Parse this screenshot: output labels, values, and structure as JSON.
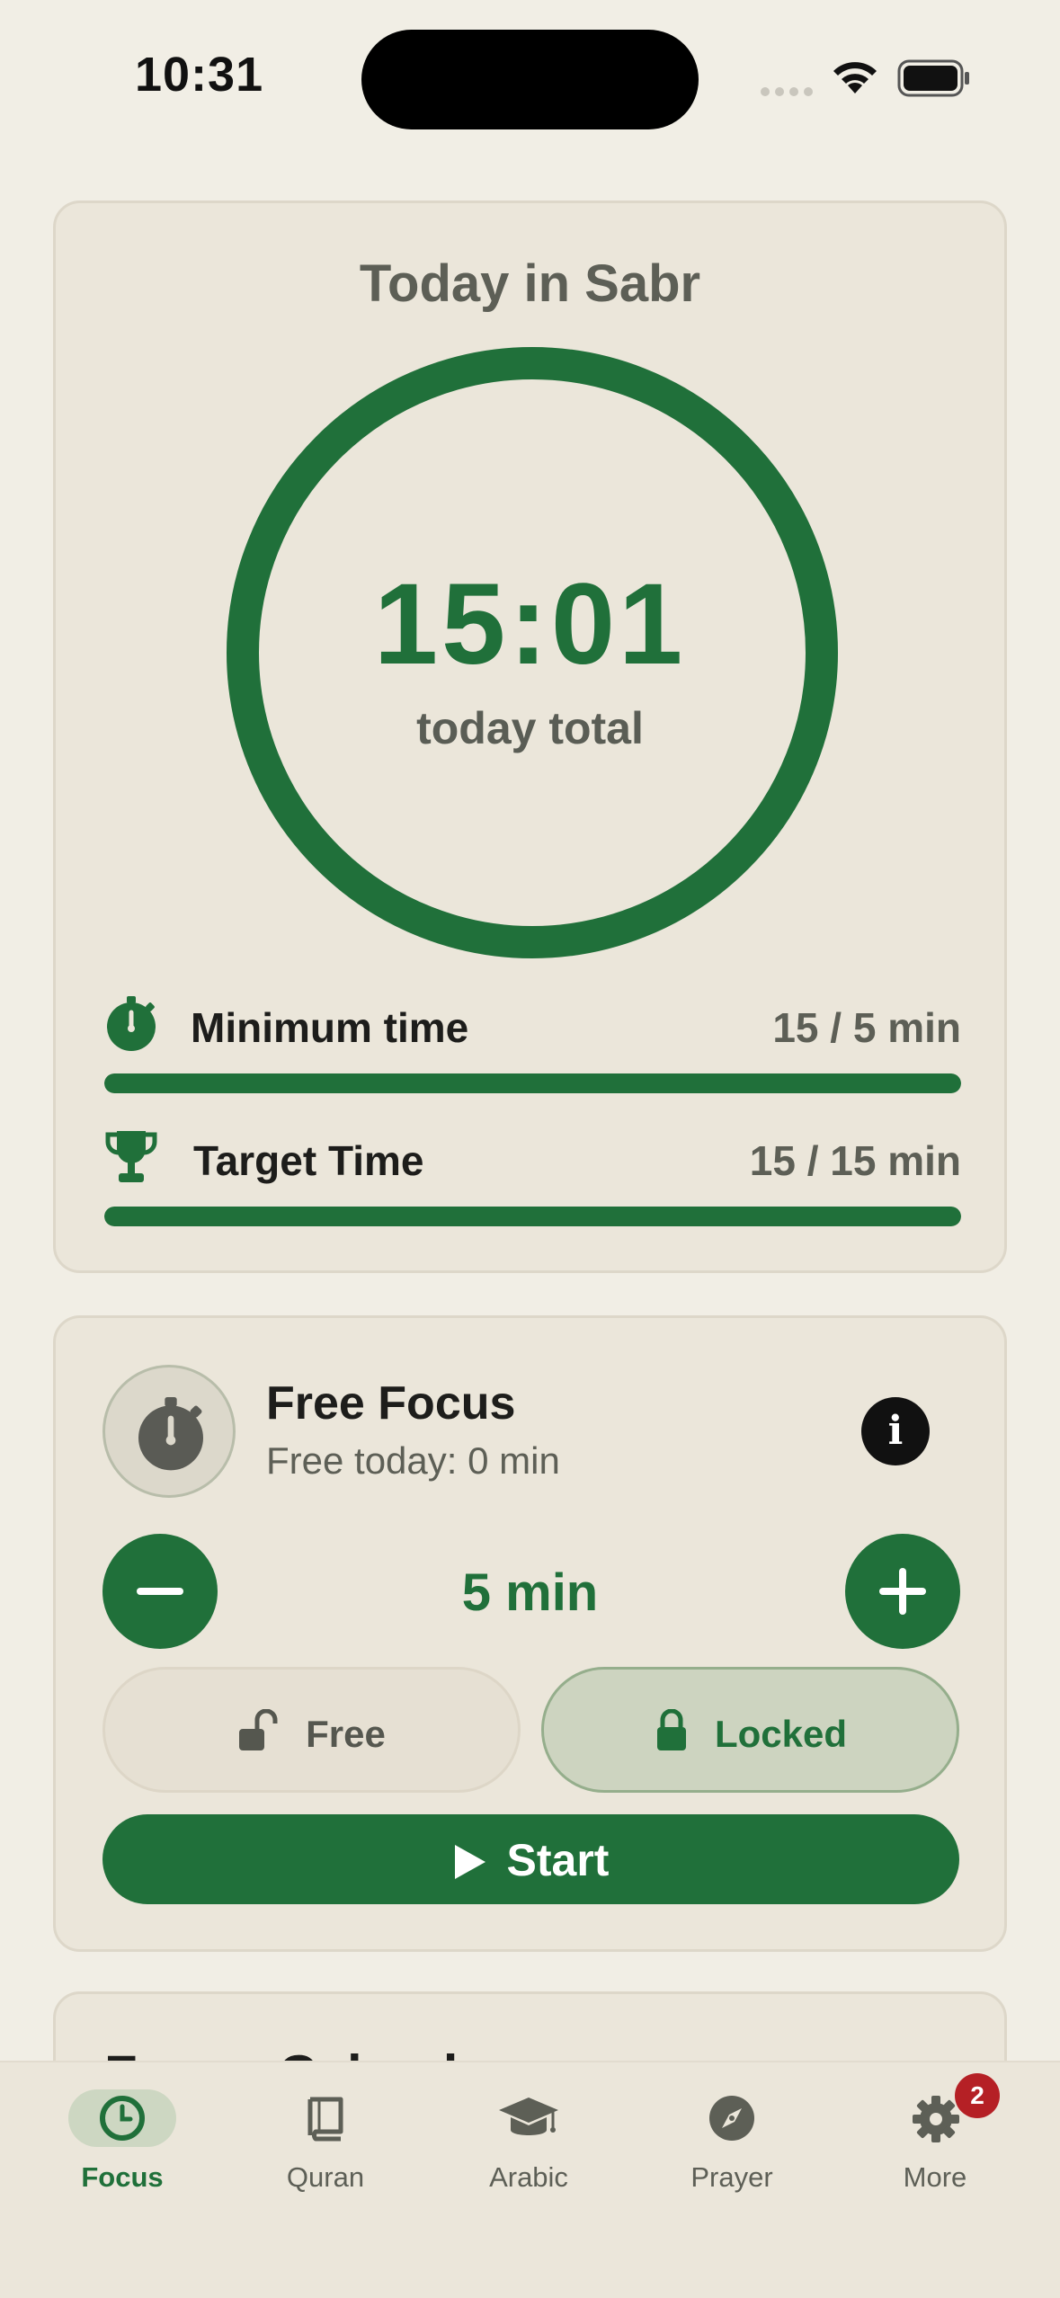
{
  "status_bar": {
    "time": "10:31"
  },
  "today": {
    "title": "Today in Sabr",
    "total_time": "15:01",
    "total_label": "today total",
    "ring_progress": 1.0,
    "goals": [
      {
        "icon": "stopwatch-icon",
        "label": "Minimum time",
        "value": "15 / 5 min",
        "progress": 1.0
      },
      {
        "icon": "trophy-icon",
        "label": "Target Time",
        "value": "15 / 15 min",
        "progress": 1.0
      }
    ]
  },
  "focus": {
    "title": "Free Focus",
    "subtitle": "Free today: 0 min",
    "duration": "5 min",
    "modes": {
      "free": "Free",
      "locked": "Locked",
      "selected": "locked"
    },
    "start_label": "Start"
  },
  "next_card": {
    "title": "Focus Calendar"
  },
  "tabs": [
    {
      "label": "Focus",
      "icon": "clock-icon",
      "active": true
    },
    {
      "label": "Quran",
      "icon": "book-icon",
      "active": false
    },
    {
      "label": "Arabic",
      "icon": "graduation-cap-icon",
      "active": false
    },
    {
      "label": "Prayer",
      "icon": "compass-icon",
      "active": false
    },
    {
      "label": "More",
      "icon": "gear-icon",
      "active": false,
      "badge": "2"
    }
  ],
  "colors": {
    "accent": "#20703a",
    "background": "#f1eee5",
    "card": "#ebe6da",
    "badge": "#b52025"
  }
}
